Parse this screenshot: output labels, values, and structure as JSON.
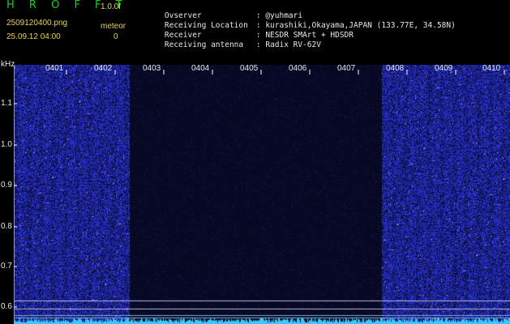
{
  "header": {
    "brand": "H R O F F T",
    "version": "1.0.0f",
    "filename": "2509120400.png",
    "mode": "meteor",
    "datetime": "25.09.12 04:00",
    "count": "0"
  },
  "meta": [
    {
      "label": "Ovserver",
      "value": ": @yuhmari"
    },
    {
      "label": "Receiving Location",
      "value": ": kurashiki,Okayama,JAPAN (133.77E, 34.58N)"
    },
    {
      "label": "Receiver",
      "value": ": NESDR SMArt + HDSDR"
    },
    {
      "label": "Receiving antenna",
      "value": ": Radix RV-62V"
    }
  ],
  "axis": {
    "unit": "kHz",
    "y_ticks": [
      "1.1",
      "1.0",
      "0.9",
      "0.8",
      "0.7",
      "0.6"
    ],
    "x_ticks": [
      "0401",
      "0402",
      "0403",
      "0404",
      "0405",
      "0406",
      "0407",
      "0408",
      "0409",
      "0410"
    ]
  },
  "chart_data": {
    "type": "heatmap",
    "ylabel": "kHz",
    "y_ticks": [
      1.1,
      1.0,
      0.9,
      0.8,
      0.7,
      0.6
    ],
    "x_ticks": [
      "0401",
      "0402",
      "0403",
      "0404",
      "0405",
      "0406",
      "0407",
      "0408",
      "0409",
      "0410"
    ],
    "colors": {
      "background": "#060820",
      "noise": "#2a34b8",
      "bright_noise": "#6f7cff",
      "baseline_trace": "#3ac8ff",
      "reference_line": "#b8b8d8"
    }
  }
}
